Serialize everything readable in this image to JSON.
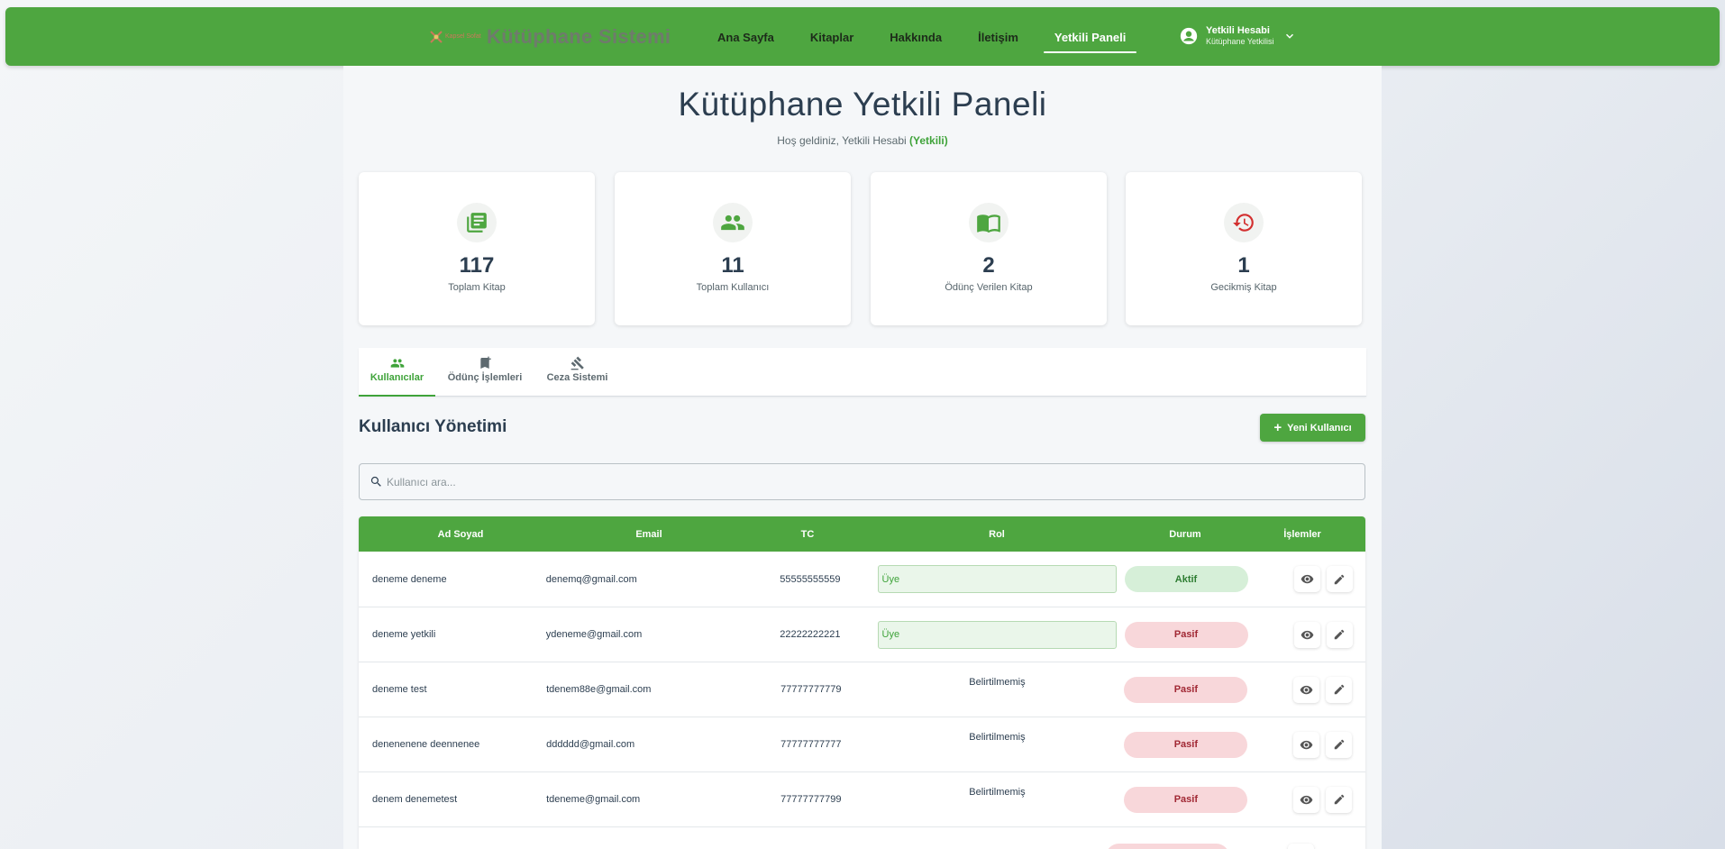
{
  "nav": {
    "brand_small": "Kapsel Sofat",
    "brand_title": "Kütüphane Sistemi",
    "links": [
      "Ana Sayfa",
      "Kitaplar",
      "Hakkında",
      "İletişim",
      "Yetkili Paneli"
    ],
    "account_name": "Yetkili Hesabi",
    "account_role": "Kütüphane Yetkilisi"
  },
  "header": {
    "title": "Kütüphane Yetkili Paneli",
    "welcome": "Hoş geldiniz, Yetkili Hesabi",
    "role": "(Yetkili)"
  },
  "stats": [
    {
      "value": "117",
      "label": "Toplam Kitap",
      "icon": "book-stack-icon"
    },
    {
      "value": "11",
      "label": "Toplam Kullanıcı",
      "icon": "users-icon"
    },
    {
      "value": "2",
      "label": "Ödünç Verilen Kitap",
      "icon": "open-book-icon"
    },
    {
      "value": "1",
      "label": "Gecikmiş Kitap",
      "icon": "history-icon"
    }
  ],
  "tabs": [
    "Kullanıcılar",
    "Ödünç İşlemleri",
    "Ceza Sistemi"
  ],
  "section": {
    "title": "Kullanıcı Yönetimi",
    "new_user": "Yeni Kullanıcı",
    "search_placeholder": "Kullanıcı ara..."
  },
  "table": {
    "headers": [
      "Ad Soyad",
      "Email",
      "TC",
      "Rol",
      "Durum",
      "İşlemler"
    ],
    "rows": [
      {
        "name": "deneme deneme",
        "email": "denemq@gmail.com",
        "tc": "55555555559",
        "role": "Üye",
        "status": "Aktif"
      },
      {
        "name": "deneme yetkili",
        "email": "ydeneme@gmail.com",
        "tc": "22222222221",
        "role": "Üye",
        "status": "Pasif"
      },
      {
        "name": "deneme test",
        "email": "tdenem88e@gmail.com",
        "tc": "77777777779",
        "role": "Belirtilmemiş",
        "status": "Pasif"
      },
      {
        "name": "denenenene deennenee",
        "email": "dddddd@gmail.com",
        "tc": "77777777777",
        "role": "Belirtilmemiş",
        "status": "Pasif"
      },
      {
        "name": "denem denemetest",
        "email": "tdeneme@gmail.com",
        "tc": "77777777799",
        "role": "Belirtilmemiş",
        "status": "Pasif"
      }
    ]
  },
  "colors": {
    "primary": "#4ea640",
    "aktif_bg": "#d6efd8",
    "pasif_bg": "#f8d7da",
    "overdue_icon": "#d32f2f"
  }
}
